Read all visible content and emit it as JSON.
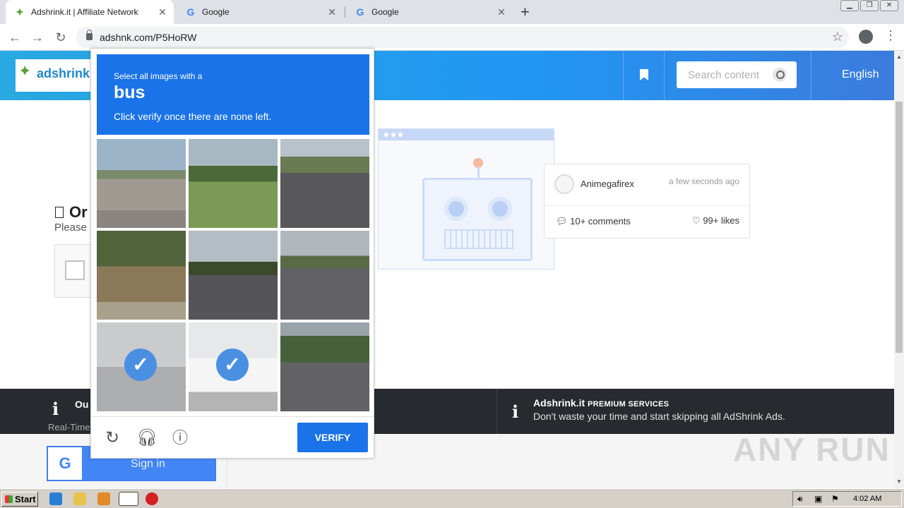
{
  "browser": {
    "tabs": [
      {
        "title": "Adshrink.it | Affiliate Network",
        "favicon": "adshrink-bird-icon"
      },
      {
        "title": "Google",
        "favicon": "google-g-icon"
      },
      {
        "title": "Google",
        "favicon": "google-g-icon"
      }
    ],
    "url": "adshnk.com/P5HoRW"
  },
  "site": {
    "logo": "adshrink.it",
    "search_placeholder": "Search content",
    "language": "English",
    "left_heading": "Or",
    "left_sub": "Please",
    "card": {
      "user": "Animegafirex",
      "time": "a few seconds ago",
      "comments": "10+ comments",
      "likes": "99+ likes"
    },
    "dark_left_title": "Ou",
    "dark_left_sub": "Real-Time",
    "premium_brand": "Adshrink.it",
    "premium_label": "PREMIUM SERVICES",
    "premium_sub": "Don't waste your time and start skipping all AdShrink Ads.",
    "signin": "Sign in"
  },
  "captcha": {
    "line1": "Select all images with a",
    "keyword": "bus",
    "line3": "Click verify once there are none left.",
    "verify_label": "VERIFY",
    "tiles": [
      {
        "selected": false
      },
      {
        "selected": false
      },
      {
        "selected": false
      },
      {
        "selected": false
      },
      {
        "selected": false
      },
      {
        "selected": false
      },
      {
        "selected": true
      },
      {
        "selected": true
      },
      {
        "selected": false
      }
    ]
  },
  "watermark": "ANY RUN",
  "taskbar": {
    "start": "Start",
    "clock": "4:02 AM"
  },
  "colors": {
    "captcha_blue": "#1a73e8",
    "header_blue": "#2196f3",
    "dark_bar": "#272a2e"
  }
}
